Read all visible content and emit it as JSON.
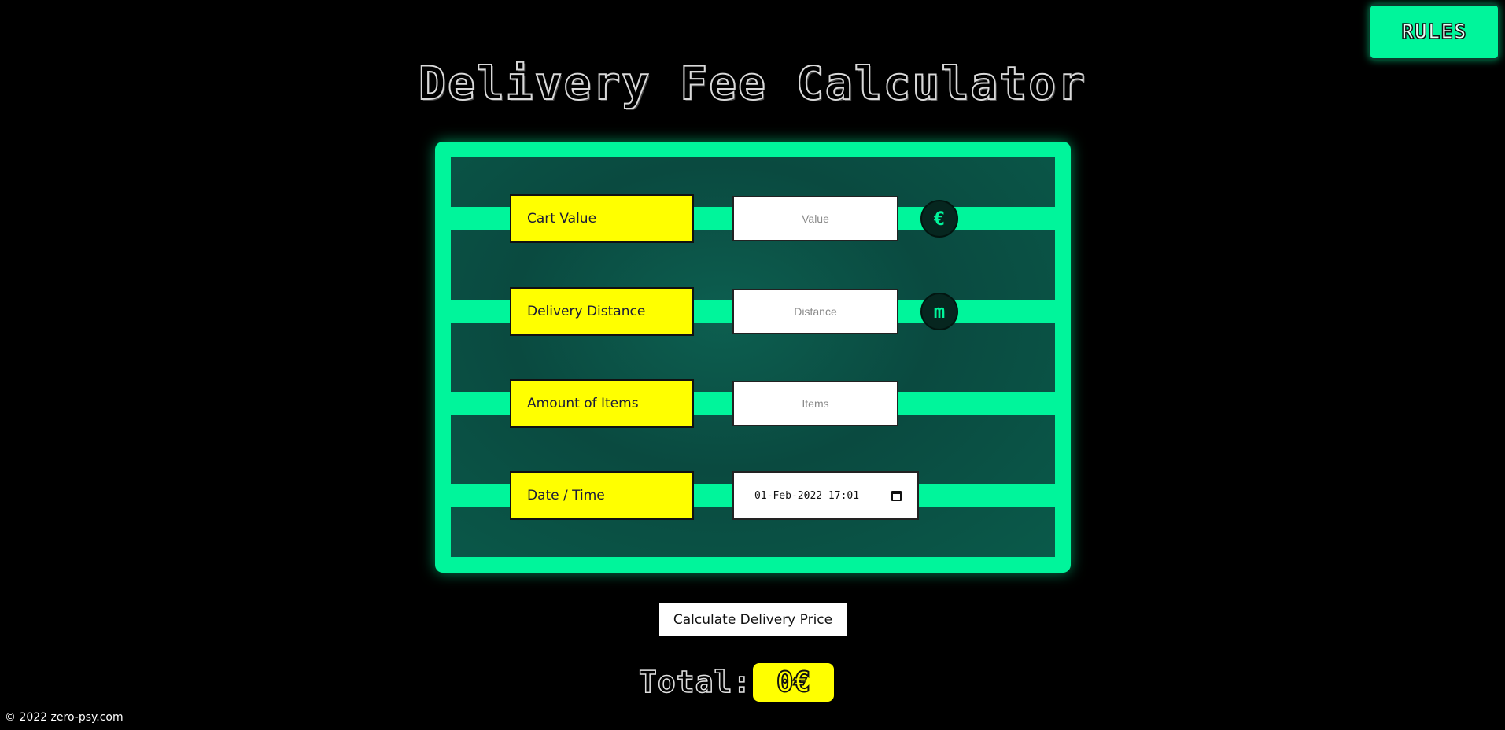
{
  "header": {
    "rules_label": "RULES",
    "title": "Delivery Fee Calculator"
  },
  "form": {
    "cart_value": {
      "label": "Cart Value",
      "placeholder": "Value",
      "unit": "€"
    },
    "delivery_distance": {
      "label": "Delivery Distance",
      "placeholder": "Distance",
      "unit": "m"
    },
    "amount_of_items": {
      "label": "Amount of Items",
      "placeholder": "Items"
    },
    "date_time": {
      "label": "Date / Time",
      "value": "01-Feb-2022 17:01",
      "icon": "calendar-icon"
    }
  },
  "actions": {
    "calculate_label": "Calculate Delivery Price"
  },
  "result": {
    "total_label": "Total:",
    "total_value": "0€"
  },
  "footer": {
    "copyright": "© 2022 zero-psy.com"
  },
  "colors": {
    "accent": "#00f59b",
    "label_bg": "#ffff00",
    "background": "#000000",
    "panel_bg": "#0a4a40"
  }
}
